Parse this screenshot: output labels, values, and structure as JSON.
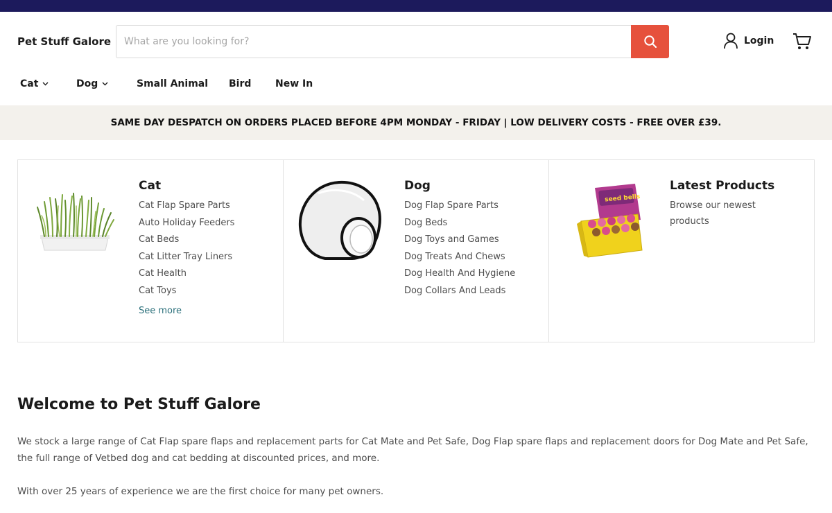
{
  "header": {
    "logo": "Pet Stuff Galore",
    "search_placeholder": "What are you looking for?",
    "login_label": "Login"
  },
  "nav": {
    "items": [
      {
        "label": "Cat",
        "dropdown": true
      },
      {
        "label": "Dog",
        "dropdown": true
      },
      {
        "label": "Small Animal",
        "dropdown": false
      },
      {
        "label": "Bird",
        "dropdown": false
      },
      {
        "label": "New In",
        "dropdown": false
      }
    ]
  },
  "promo": "SAME DAY DESPATCH ON ORDERS PLACED BEFORE 4PM MONDAY - FRIDAY | LOW DELIVERY COSTS - FREE OVER £39.",
  "categories": [
    {
      "title": "Cat",
      "links": [
        "Cat Flap Spare Parts",
        "Auto Holiday Feeders",
        "Cat Beds",
        "Cat Litter Tray Liners",
        "Cat Health",
        "Cat Toys"
      ],
      "see_more": "See more"
    },
    {
      "title": "Dog",
      "links": [
        "Dog Flap Spare Parts",
        "Dog Beds",
        "Dog Toys and Games",
        "Dog Treats And Chews",
        "Dog Health And Hygiene",
        "Dog Collars And Leads"
      ]
    },
    {
      "title": "Latest Products",
      "description": "Browse our newest products",
      "box_label": "seed bells"
    }
  ],
  "welcome": {
    "title": "Welcome to Pet Stuff Galore",
    "paragraph1": "We stock a large range of Cat Flap spare flaps and replacement parts for Cat Mate and Pet Safe, Dog Flap spare flaps and replacement doors for Dog Mate and Pet Safe, the full range of Vetbed dog and cat bedding at discounted prices, and more.",
    "paragraph2": "With over 25 years of experience we are the first choice for many pet owners."
  },
  "colors": {
    "topbar": "#1c1a5c",
    "search_button": "#e6513c",
    "promo_bg": "#f3f1ec",
    "see_more_link": "#2a6f7a"
  },
  "icons": [
    "search-icon",
    "user-icon",
    "cart-icon",
    "chevron-down-icon"
  ]
}
